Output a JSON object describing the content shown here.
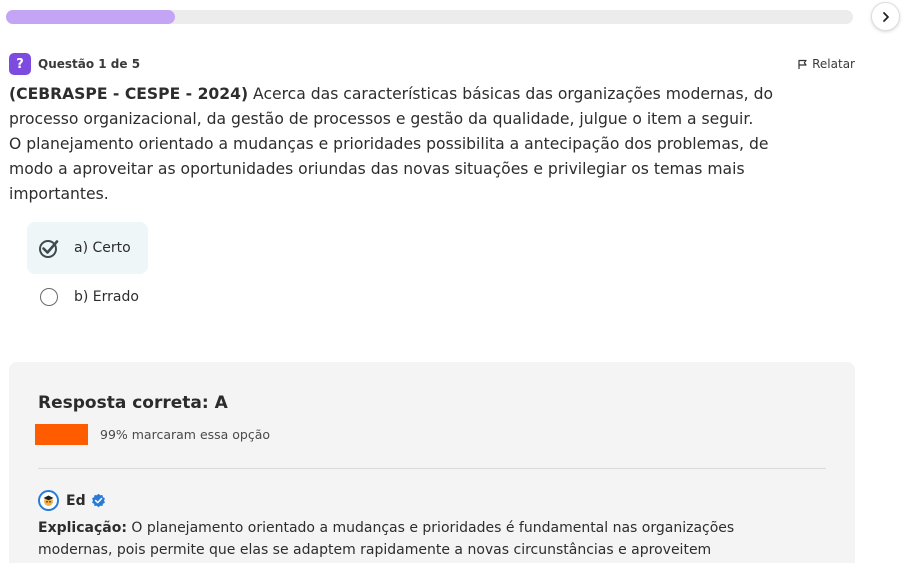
{
  "progress": {
    "fraction": 0.2,
    "fill_color": "#c4a4f5"
  },
  "nav": {
    "next_icon": "chevron-right-icon"
  },
  "question": {
    "icon_glyph": "?",
    "counter": "Questão 1 de 5",
    "report_label": "Relatar",
    "source": "(CEBRASPE - CESPE - 2024)",
    "statement_line1_rest": " Acerca das características básicas das organizações modernas, do",
    "statement_line2": "processo organizacional, da gestão de processos e gestão da qualidade, julgue o item a seguir.",
    "statement_line3": "O planejamento orientado a mudanças e prioridades possibilita a antecipação dos problemas, de",
    "statement_line4": "modo a aproveitar as oportunidades oriundas das novas situações e privilegiar os temas mais",
    "statement_line5": "importantes."
  },
  "options": [
    {
      "label": "a) Certo",
      "selected": true,
      "icon": "check-circle-icon"
    },
    {
      "label": "b) Errado",
      "selected": false,
      "icon": "radio-empty-icon"
    }
  ],
  "answer": {
    "title": "Resposta correta: A",
    "stat_text": "99% marcaram essa opção",
    "stat_color": "#ff5c00",
    "author_name": "Ed",
    "explanation_label": "Explicação:",
    "explanation_line1_rest": " O planejamento orientado a mudanças e prioridades é fundamental nas organizações",
    "explanation_line2": "modernas, pois permite que elas se adaptem rapidamente a novas circunstâncias e aproveitem"
  },
  "colors": {
    "accent": "#7d4be0",
    "verified": "#2b7bd6"
  }
}
